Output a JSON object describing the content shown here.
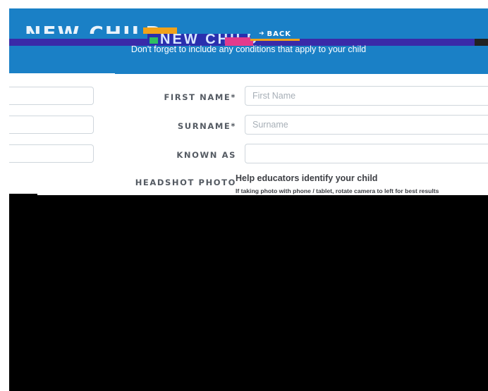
{
  "header": {
    "title": "NEW CHILD",
    "back_label": "BACK",
    "back_icon": "arrow-left-icon",
    "subtitle": "Don't forget to include any conditions that apply to your child",
    "banner_color": "#1a80c6",
    "accent_color": "#f0a21a"
  },
  "form": {
    "first_name": {
      "label": "FIRST NAME*",
      "placeholder": "First Name",
      "value": ""
    },
    "surname": {
      "label": "SURNAME*",
      "placeholder": "Surname",
      "value": ""
    },
    "known_as": {
      "label": "KNOWN AS",
      "placeholder": "",
      "value": ""
    },
    "headshot": {
      "label": "HEADSHOT PHOTO",
      "heading": "Help educators identify your child",
      "hint": "If taking photo with phone / tablet, rotate camera to left for best results"
    }
  }
}
